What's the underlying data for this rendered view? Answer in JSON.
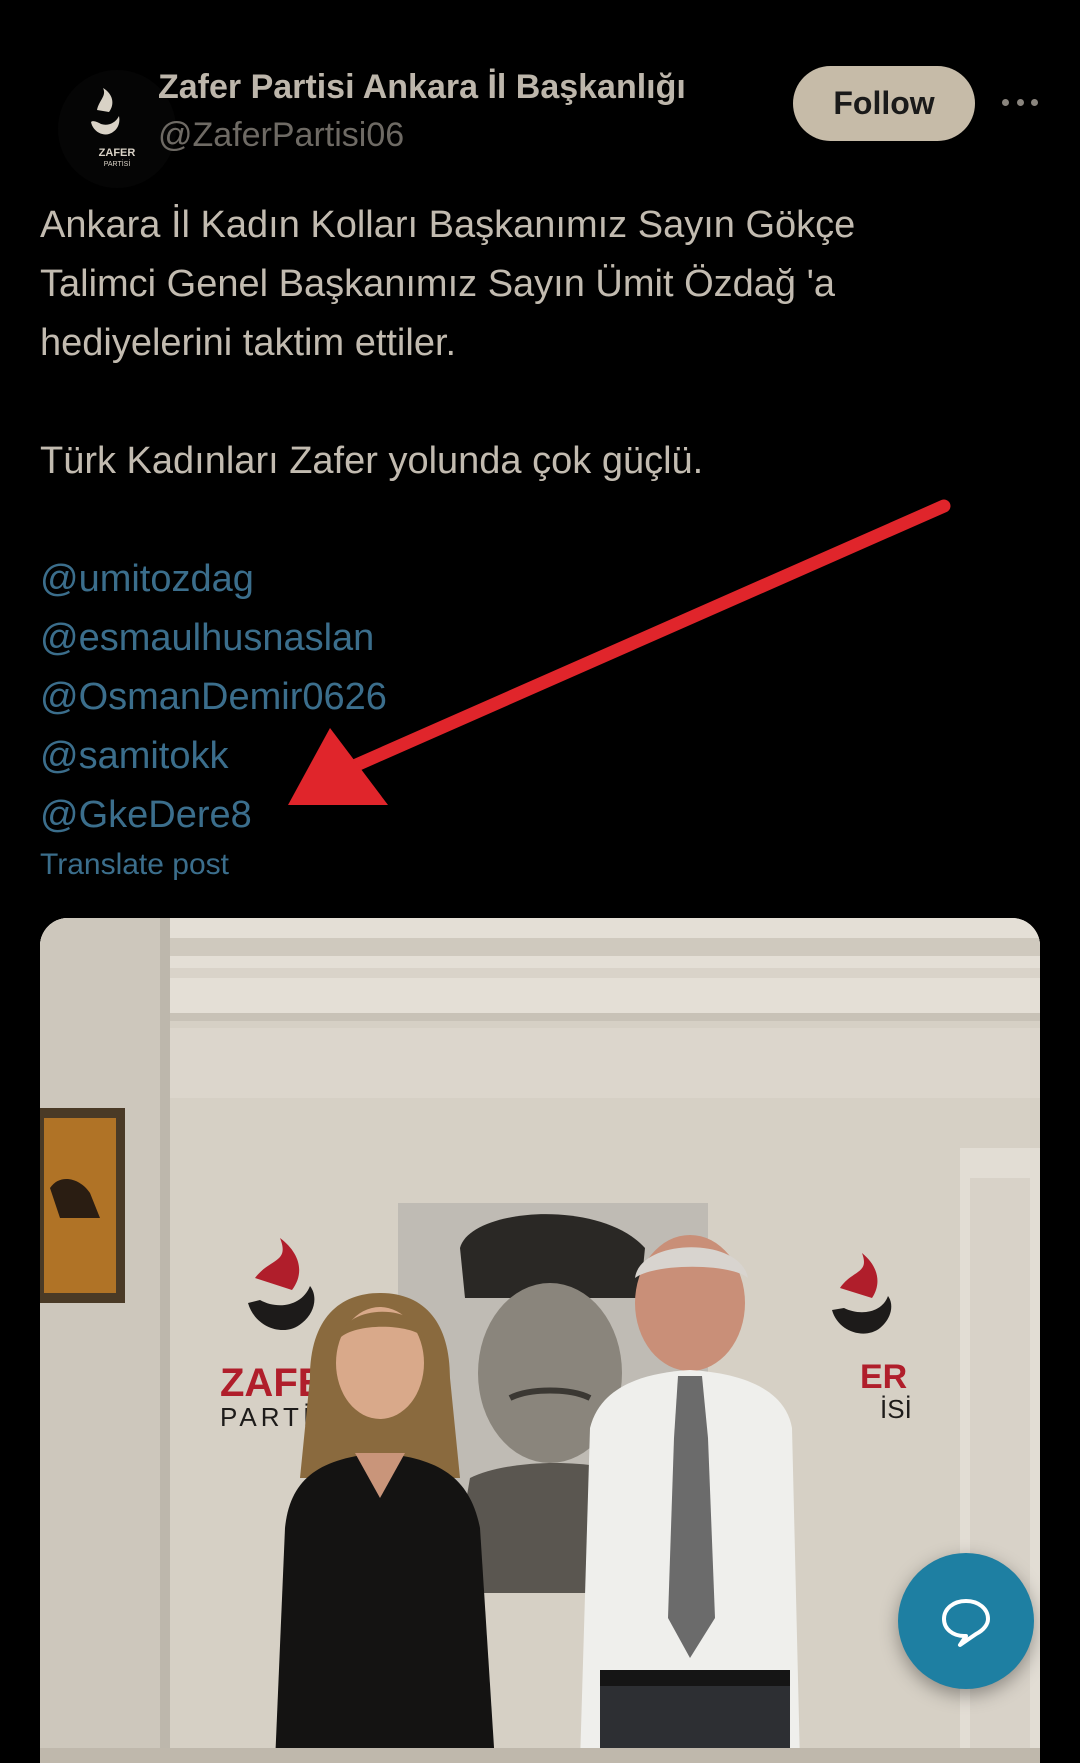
{
  "header": {
    "display_name": "Zafer Partisi Ankara İl Başkanlığı",
    "handle": "@ZaferPartisi06",
    "follow_label": "Follow",
    "avatar_text": "ZAFER",
    "avatar_subtext": "PARTİSİ"
  },
  "tweet": {
    "line1": "Ankara İl Kadın Kolları Başkanımız Sayın Gökçe",
    "line2": "Talimci Genel Başkanımız Sayın Ümit Özdağ 'a",
    "line3": "hediyelerini taktim ettiler.",
    "line4": "Türk Kadınları Zafer yolunda çok güçlü.",
    "mentions": [
      "@umitozdag",
      "@esmaulhusnaslan",
      "@OsmanDemir0626",
      "@samitokk",
      "@GkeDere8"
    ],
    "translate_label": "Translate post"
  },
  "photo": {
    "logo_left_text": "ZAFER",
    "logo_left_sub": "PARTİ",
    "logo_right_text": "ER",
    "logo_right_sub": "İSİ"
  },
  "icons": {
    "more": "more-horizontal-icon",
    "compose": "chat-bubble-icon",
    "annotation": "red-arrow"
  },
  "colors": {
    "background": "#000000",
    "text": "#c2bbb0",
    "link": "#3b6e8c",
    "follow_button": "#c6bba8",
    "arrow": "#e0252b",
    "fab": "#1e7fa2"
  }
}
